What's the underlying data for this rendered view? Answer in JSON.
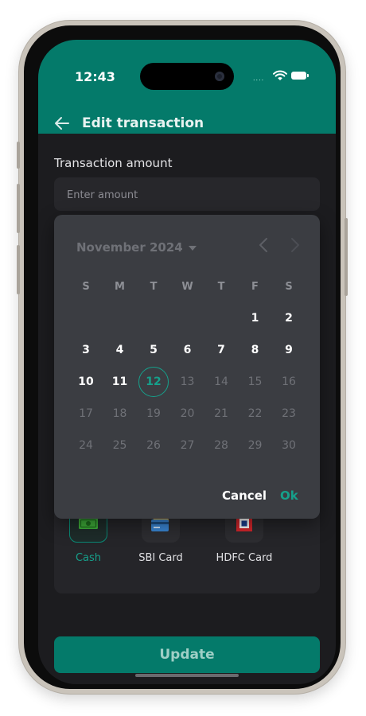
{
  "status_bar": {
    "time": "12:43",
    "dots": "....",
    "icons": [
      "wifi-icon",
      "battery-icon"
    ]
  },
  "header": {
    "title": "Edit transaction",
    "back_icon": "arrow-left-icon"
  },
  "form": {
    "amount_label": "Transaction amount",
    "amount_value": "",
    "amount_placeholder": "Enter amount"
  },
  "date_picker": {
    "month_label": "November 2024",
    "weekdays": [
      "S",
      "M",
      "T",
      "W",
      "T",
      "F",
      "S"
    ],
    "selected_day": 12,
    "weeks": [
      [
        "",
        "",
        "",
        "",
        "",
        "1",
        "2"
      ],
      [
        "3",
        "4",
        "5",
        "6",
        "7",
        "8",
        "9"
      ],
      [
        "10",
        "11",
        "12",
        "13",
        "14",
        "15",
        "16"
      ],
      [
        "17",
        "18",
        "19",
        "20",
        "21",
        "22",
        "23"
      ],
      [
        "24",
        "25",
        "26",
        "27",
        "28",
        "29",
        "30"
      ]
    ],
    "enabled_days": [
      1,
      2,
      3,
      4,
      5,
      6,
      7,
      8,
      9,
      10,
      11,
      12
    ],
    "cancel_label": "Cancel",
    "ok_label": "Ok"
  },
  "accounts": [
    {
      "label": "Cash",
      "icon": "cash-icon",
      "selected": true
    },
    {
      "label": "SBI Card",
      "icon": "credit-card-icon",
      "selected": false
    },
    {
      "label": "HDFC Card",
      "icon": "hdfc-logo-icon",
      "selected": false
    }
  ],
  "footer": {
    "update_label": "Update"
  },
  "colors": {
    "accent": "#047a6a",
    "accent_text": "#16a08b",
    "background": "#1c1c1f",
    "dialog": "#3b3d42"
  }
}
